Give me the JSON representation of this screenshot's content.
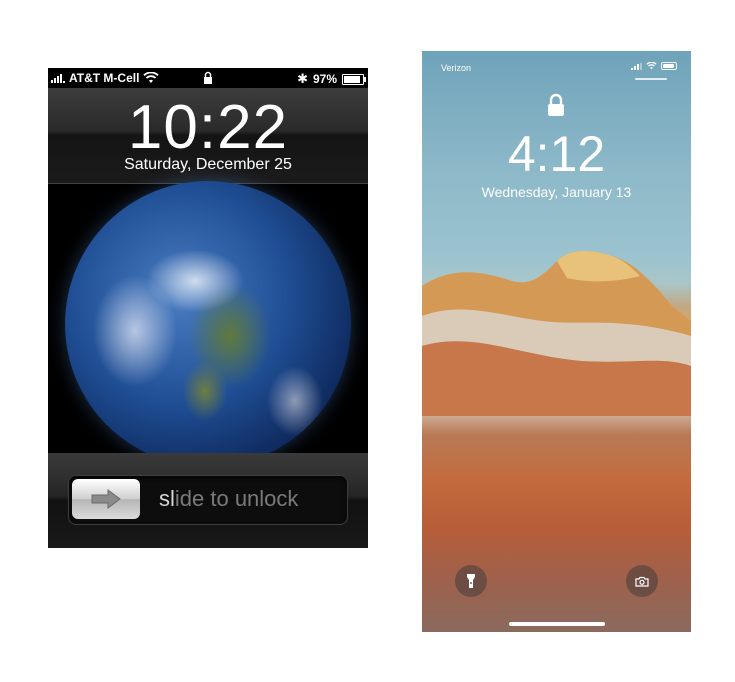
{
  "old_phone": {
    "status": {
      "carrier": "AT&T M-Cell",
      "battery": "97%",
      "battery_level": 0.97
    },
    "time": "10:22",
    "date": "Saturday, December 25",
    "slider": {
      "highlight": "sl",
      "rest": "ide to unlock"
    }
  },
  "new_phone": {
    "status": {
      "carrier": "Verizon"
    },
    "time": "4:12",
    "date": "Wednesday, January 13"
  }
}
